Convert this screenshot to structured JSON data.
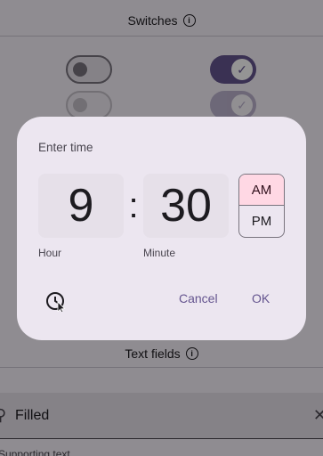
{
  "background": {
    "switches_title": "Switches",
    "text_fields_title": "Text fields",
    "filled_label": "Filled",
    "supporting_text": "Supporting text"
  },
  "dialog": {
    "title": "Enter time",
    "hour": "9",
    "separator": ":",
    "minute": "30",
    "am_label": "AM",
    "pm_label": "PM",
    "selected_period": "AM",
    "hour_label": "Hour",
    "minute_label": "Minute",
    "cancel_label": "Cancel",
    "ok_label": "OK"
  },
  "icons": {
    "info": "info-icon",
    "check": "check-icon",
    "clock": "clock-icon",
    "search": "search-icon",
    "close": "close-icon"
  },
  "colors": {
    "primary": "#65558f",
    "dialog_surface": "#ece6f0",
    "am_selected": "#ffd8e4",
    "time_box": "#e6e0e9"
  }
}
